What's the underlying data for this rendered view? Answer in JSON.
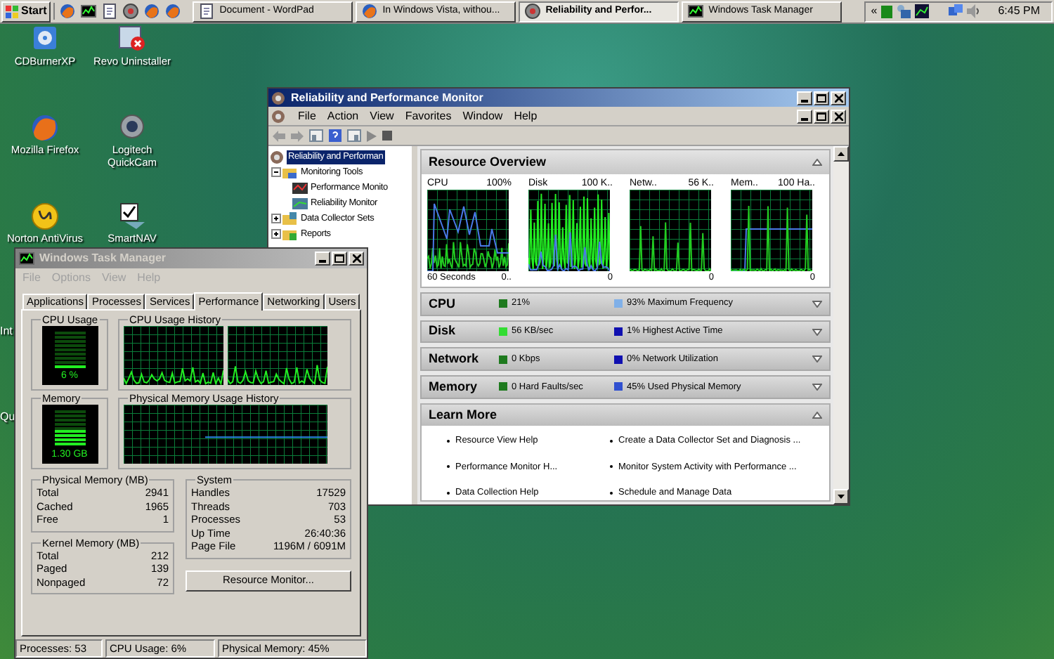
{
  "taskbar": {
    "start": "Start",
    "tasks": [
      {
        "label": "Document - WordPad",
        "selected": false,
        "kind": "document"
      },
      {
        "label": "In Windows Vista, withou...",
        "selected": false,
        "kind": "browser"
      },
      {
        "label": "Reliability and Perfor...",
        "selected": true,
        "kind": "monitor"
      },
      {
        "label": "Windows Task Manager",
        "selected": false,
        "kind": "taskmgr"
      }
    ],
    "tray_expand": "«",
    "clock": "6:45 PM"
  },
  "desktop_icons": [
    {
      "label": "CDBurnerXP",
      "kind": "disc"
    },
    {
      "label": "Revo Uninstaller",
      "kind": "uninstaller"
    },
    {
      "label": "Mozilla Firefox",
      "kind": "browser"
    },
    {
      "label": "Logitech QuickCam",
      "kind": "webcam"
    },
    {
      "label": "Norton AntiVirus",
      "kind": "antivirus"
    },
    {
      "label": "SmartNAV",
      "kind": "pointer"
    }
  ],
  "cut_labels": [
    "Int",
    "Qu"
  ],
  "perf_monitor": {
    "title": "Reliability and Performance Monitor",
    "menu": [
      "File",
      "Action",
      "View",
      "Favorites",
      "Window",
      "Help"
    ],
    "tree": [
      {
        "label": "Reliability and Performan",
        "selected": true,
        "kind": "root",
        "children": [
          {
            "label": "Monitoring Tools",
            "selected": false,
            "kind": "folder",
            "expanded": true,
            "children": [
              {
                "label": "Performance Monito",
                "selected": false,
                "kind": "perf"
              },
              {
                "label": "Reliability Monitor",
                "selected": false,
                "kind": "reliability"
              }
            ]
          },
          {
            "label": "Data Collector Sets",
            "selected": false,
            "kind": "sets",
            "expanded": false
          },
          {
            "label": "Reports",
            "selected": false,
            "kind": "reports",
            "expanded": false
          }
        ]
      }
    ],
    "overview": {
      "title": "Resource Overview",
      "expanded": true,
      "graphs": [
        {
          "label": "CPU",
          "max": "100%",
          "min": "0..",
          "time": "60 Seconds"
        },
        {
          "label": "Disk",
          "max": "100 K..",
          "min": "0"
        },
        {
          "label": "Netw..",
          "max": "56 K..",
          "min": "0"
        },
        {
          "label": "Mem..",
          "max": "100 Ha..",
          "min": "0"
        }
      ]
    },
    "sections": [
      {
        "name": "CPU",
        "expanded": false,
        "metrics": [
          {
            "text": "21%",
            "color": "#1e7a1e"
          },
          {
            "text": "93% Maximum Frequency",
            "color": "#80b0e8"
          }
        ]
      },
      {
        "name": "Disk",
        "expanded": false,
        "metrics": [
          {
            "text": "56 KB/sec",
            "color": "#33dd33"
          },
          {
            "text": "1% Highest Active Time",
            "color": "#1010b0"
          }
        ]
      },
      {
        "name": "Network",
        "expanded": false,
        "metrics": [
          {
            "text": "0 Kbps",
            "color": "#1e7a1e"
          },
          {
            "text": "0% Network Utilization",
            "color": "#1010b0"
          }
        ]
      },
      {
        "name": "Memory",
        "expanded": false,
        "metrics": [
          {
            "text": "0 Hard Faults/sec",
            "color": "#1e7a1e"
          },
          {
            "text": "45% Used Physical Memory",
            "color": "#3050d0"
          }
        ]
      }
    ],
    "learn_more": {
      "title": "Learn More",
      "expanded": true,
      "links": [
        "Resource View Help",
        "Create a Data Collector Set and Diagnosis ...",
        "Performance Monitor H...",
        "Monitor System Activity with Performance ...",
        "Data Collection Help",
        "Schedule and Manage Data"
      ]
    }
  },
  "task_manager": {
    "title": "Windows Task Manager",
    "menu": [
      {
        "label": "File",
        "disabled": true
      },
      {
        "label": "Options",
        "disabled": true
      },
      {
        "label": "View",
        "disabled": true
      },
      {
        "label": "Help",
        "disabled": true
      }
    ],
    "tabs": [
      {
        "label": "Applications",
        "selected": false
      },
      {
        "label": "Processes",
        "selected": false
      },
      {
        "label": "Services",
        "selected": false
      },
      {
        "label": "Performance",
        "selected": true
      },
      {
        "label": "Networking",
        "selected": false
      },
      {
        "label": "Users",
        "selected": false
      }
    ],
    "cpu_usage": {
      "title": "CPU Usage",
      "reading": "6 %",
      "level": 0.06
    },
    "cpu_history": {
      "title": "CPU Usage History"
    },
    "memory": {
      "title": "Memory",
      "reading": "1.30 GB",
      "level": 0.45
    },
    "memory_history": {
      "title": "Physical Memory Usage History"
    },
    "physical_memory": {
      "title": "Physical Memory (MB)",
      "rows": [
        {
          "label": "Total",
          "value": "2941"
        },
        {
          "label": "Cached",
          "value": "1965"
        },
        {
          "label": "Free",
          "value": "1"
        }
      ]
    },
    "kernel_memory": {
      "title": "Kernel Memory (MB)",
      "rows": [
        {
          "label": "Total",
          "value": "212"
        },
        {
          "label": "Paged",
          "value": "139"
        },
        {
          "label": "Nonpaged",
          "value": "72"
        }
      ]
    },
    "system": {
      "title": "System",
      "rows": [
        {
          "label": "Handles",
          "value": "17529"
        },
        {
          "label": "Threads",
          "value": "703"
        },
        {
          "label": "Processes",
          "value": "53"
        },
        {
          "label": "Up Time",
          "value": "26:40:36"
        },
        {
          "label": "Page File",
          "value": "1196M / 6091M"
        }
      ]
    },
    "button": "Resource Monitor...",
    "status_bar": [
      "Processes: 53",
      "CPU Usage: 6%",
      "Physical Memory: 45%"
    ]
  }
}
